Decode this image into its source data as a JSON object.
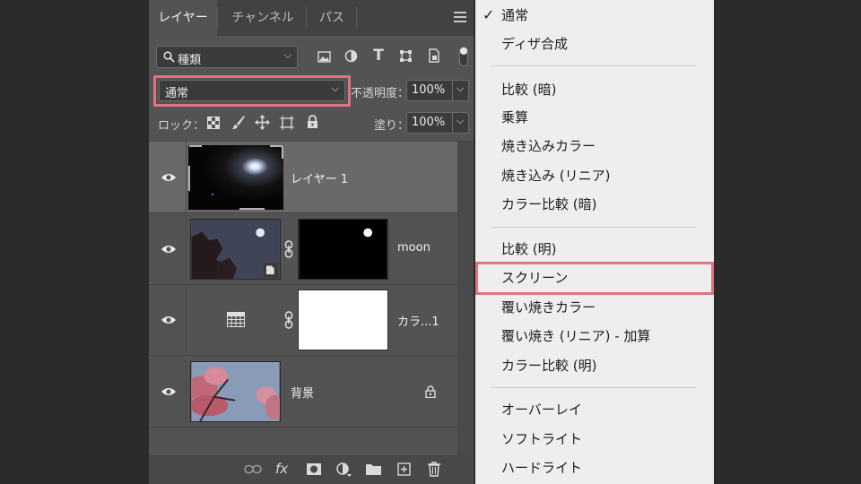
{
  "layers_panel": {
    "tabs": [
      "レイヤー",
      "チャンネル",
      "パス"
    ],
    "filter_label": "種類",
    "blend_mode": "通常",
    "opacity_label": "不透明度：",
    "opacity_value": "100%",
    "lock_label": "ロック：",
    "fill_label": "塗り：",
    "fill_value": "100%",
    "layers": [
      {
        "name": "レイヤー 1"
      },
      {
        "name": "moon"
      },
      {
        "name": "カラ...1"
      },
      {
        "name": "背景"
      }
    ],
    "bottom_fx": "fx"
  },
  "blend_menu": {
    "checkmark": "✓",
    "groups": [
      [
        "通常",
        "ディザ合成"
      ],
      [
        "比較 (暗)",
        "乗算",
        "焼き込みカラー",
        "焼き込み (リニア)",
        "カラー比較 (暗)"
      ],
      [
        "比較 (明)",
        "スクリーン",
        "覆い焼きカラー",
        "覆い焼き (リニア) - 加算",
        "カラー比較 (明)"
      ],
      [
        "オーバーレイ",
        "ソフトライト",
        "ハードライト"
      ]
    ],
    "selected": "通常",
    "highlighted": "スクリーン"
  },
  "colors": {
    "highlight": "#e2727d",
    "panel_bg": "#535353",
    "menu_bg": "#eeeeee"
  }
}
